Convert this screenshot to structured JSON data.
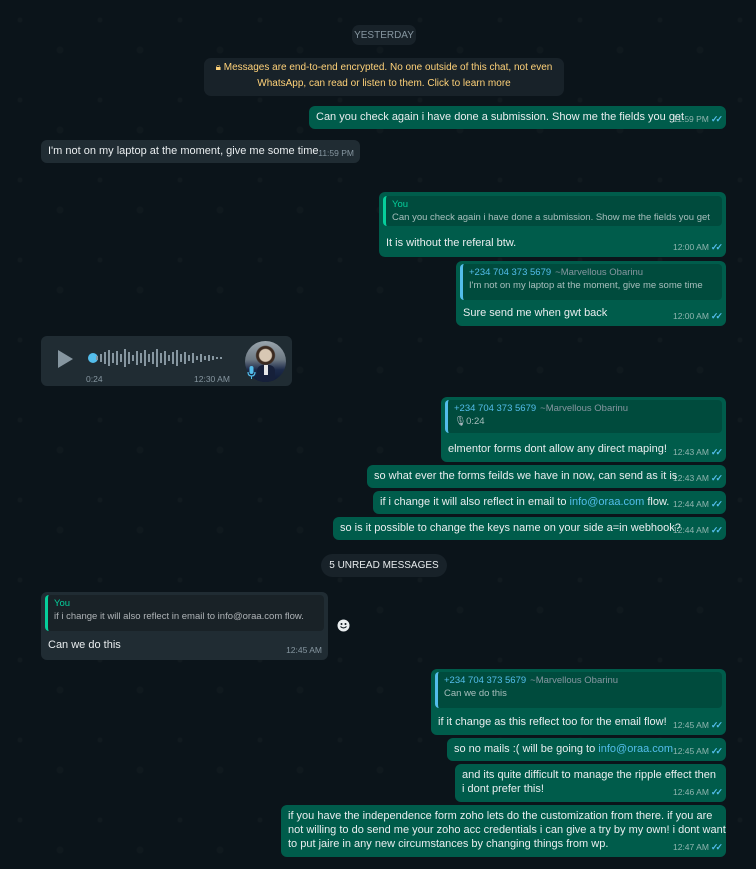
{
  "date_divider": "YESTERDAY",
  "encryption_notice": "Messages are end-to-end encrypted. No one outside of this chat, not even WhatsApp, can read or listen to them. Click to learn more",
  "unread_divider": "5 UNREAD MESSAGES",
  "messages": [
    {
      "text": "Can you check again i have done a submission. Show me the fields you get",
      "time": "11:59 PM"
    },
    {
      "text": "I'm not on my laptop at the moment, give me some time",
      "time": "11:59 PM"
    },
    {
      "quote_author": "You",
      "quote_text": "Can you check again i have done a submission. Show me the fields you get",
      "text": "It is without the referal btw.",
      "time": "12:00 AM"
    },
    {
      "quote_author": "+234 704 373 5679",
      "quote_pushname": "~Marvellous Obarinu",
      "quote_text": "I'm not on my laptop at the moment, give me some time",
      "text": "Sure send me when gwt back",
      "time": "12:00 AM"
    },
    {
      "voice_duration": "0:24",
      "time": "12:30 AM",
      "sender_avatar": "avatar-photo"
    },
    {
      "quote_author": "+234 704 373 5679",
      "quote_pushname": "~Marvellous Obarinu",
      "quote_text": "0:24",
      "text": "elmentor forms dont allow any direct maping!",
      "time": "12:43 AM"
    },
    {
      "text": "so what ever the forms feilds we have in now, can send as it is",
      "time": "12:43 AM"
    },
    {
      "text_before": "if i change it will also reflect in email to ",
      "link": "info@oraa.com",
      "text_after": " flow.",
      "time": "12:44 AM"
    },
    {
      "text": "so is it possible to change the keys name on your side a=in webhook?",
      "time": "12:44 AM"
    },
    {
      "quote_author": "You",
      "quote_text": "if i change it will also reflect in email to info@oraa.com flow.",
      "text": "Can we do this",
      "time": "12:45 AM"
    },
    {
      "quote_author": "+234 704 373 5679",
      "quote_pushname": "~Marvellous Obarinu",
      "quote_text": "Can we do this",
      "text": "if it change as this reflect too for the email flow!",
      "time": "12:45 AM"
    },
    {
      "text_before": "so no mails :( will be going to ",
      "link": "info@oraa.com",
      "time": "12:45 AM"
    },
    {
      "line1": "and its quite difficult to manage the ripple effect then",
      "line2": "i dont prefer this!",
      "time": "12:46 AM"
    },
    {
      "line1": "if you have the independence form zoho lets do the customization from there. if you are",
      "line2": "not willing to do send me your zoho acc credentials i can give a try by my own! i dont want",
      "line3": "to put jaire in any new circumstances by changing things from wp.",
      "time": "12:47 AM"
    }
  ],
  "ticks": "✓✓"
}
